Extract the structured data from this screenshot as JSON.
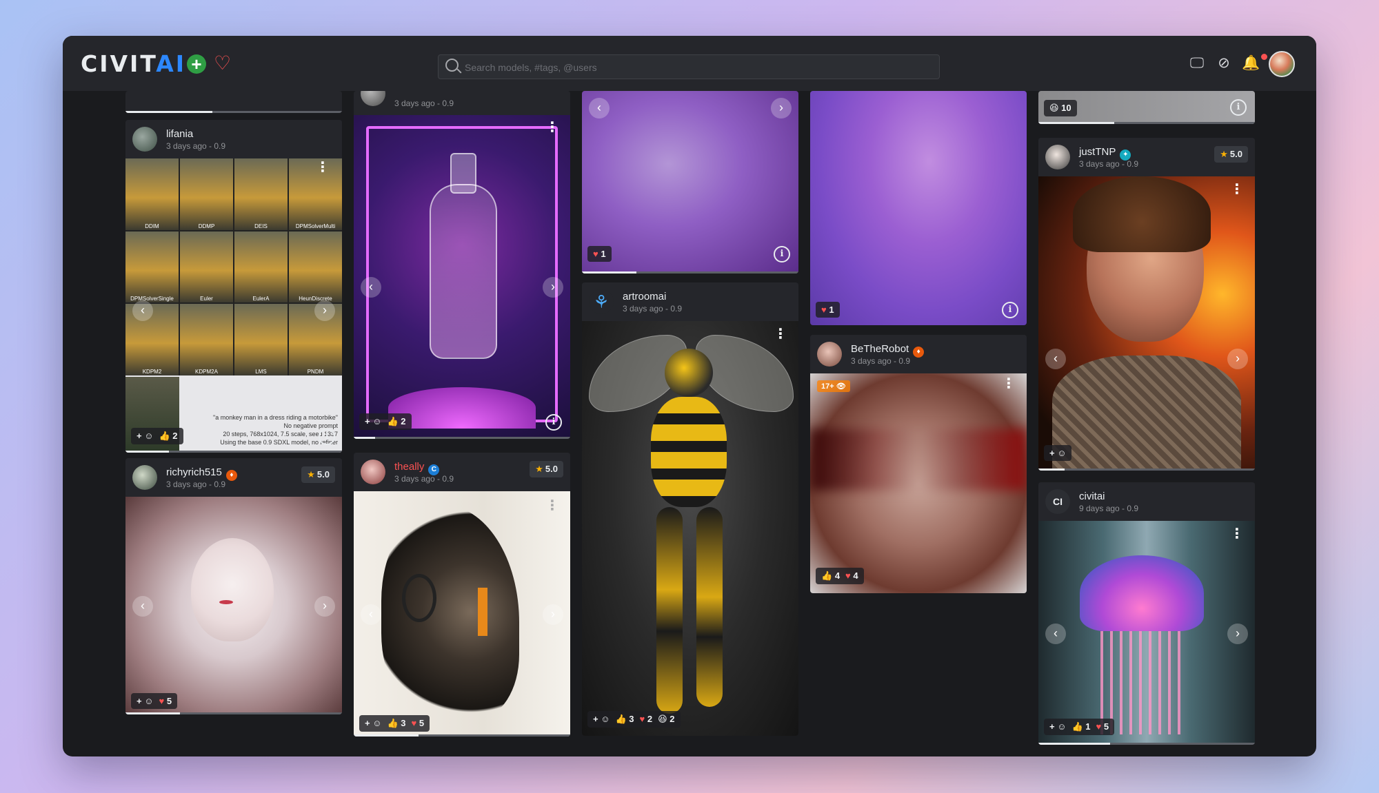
{
  "brand": {
    "name_main": "CIVIT",
    "name_accent": "AI"
  },
  "header": {
    "create_icon": "plus-circle-icon",
    "favorites_icon": "heart-icon",
    "search_placeholder": "Search models, #tags, @users",
    "icons": [
      "monitor-icon",
      "eye-off-icon",
      "bell-icon"
    ]
  },
  "cards": {
    "lifania": {
      "user": "lifania",
      "date": "3 days ago - 0.9",
      "grid_labels": [
        "DDIM",
        "DDMP",
        "DEIS",
        "DPMSolverMulti",
        "DPMSolverSingle",
        "Euler",
        "EulerA",
        "HeunDiscrete",
        "KDPM2",
        "KDPM2A",
        "LMS",
        "PNDM"
      ],
      "prompt": "\"a monkey man in a dress riding a motorbike\"",
      "neg": "No negative prompt",
      "settings": "20 steps, 768x1024, 7.5 scale, seed 1337",
      "model_note": "Using the base 0.9 SDXL model, no refiner",
      "reactions": {
        "likes": "2"
      }
    },
    "topcol2": {
      "date": "3 days ago - 0.9",
      "reactions": {
        "likes": "2"
      }
    },
    "richyrich": {
      "user": "richyrich515",
      "date": "3 days ago - 0.9",
      "rating": "5.0",
      "reactions": {
        "hearts": "5"
      }
    },
    "theally": {
      "user": "theally",
      "date": "3 days ago - 0.9",
      "rating": "5.0",
      "badge": "C",
      "reactions": {
        "likes": "3",
        "hearts": "5"
      }
    },
    "purple1": {
      "reactions": {
        "hearts": "1"
      }
    },
    "artroomai": {
      "user": "artroomai",
      "date": "3 days ago - 0.9",
      "reactions": {
        "likes": "3",
        "hearts": "2",
        "laughs": "2"
      }
    },
    "purple2": {
      "reactions": {
        "hearts": "1"
      }
    },
    "betherobot": {
      "user": "BeTheRobot",
      "date": "3 days ago - 0.9",
      "nsfw": "17+",
      "reactions": {
        "likes": "4",
        "hearts": "4"
      }
    },
    "top5": {
      "reactions": {
        "laughs": "10"
      }
    },
    "justtnp": {
      "user": "justTNP",
      "date": "3 days ago - 0.9",
      "rating": "5.0"
    },
    "civitai": {
      "user": "civitai",
      "initials": "CI",
      "date": "9 days ago - 0.9",
      "reactions": {
        "likes": "1",
        "hearts": "5"
      }
    }
  },
  "emoji": {
    "like": "👍",
    "heart": "♥",
    "laugh": "😆",
    "add": "+ ☺",
    "star": "★"
  }
}
